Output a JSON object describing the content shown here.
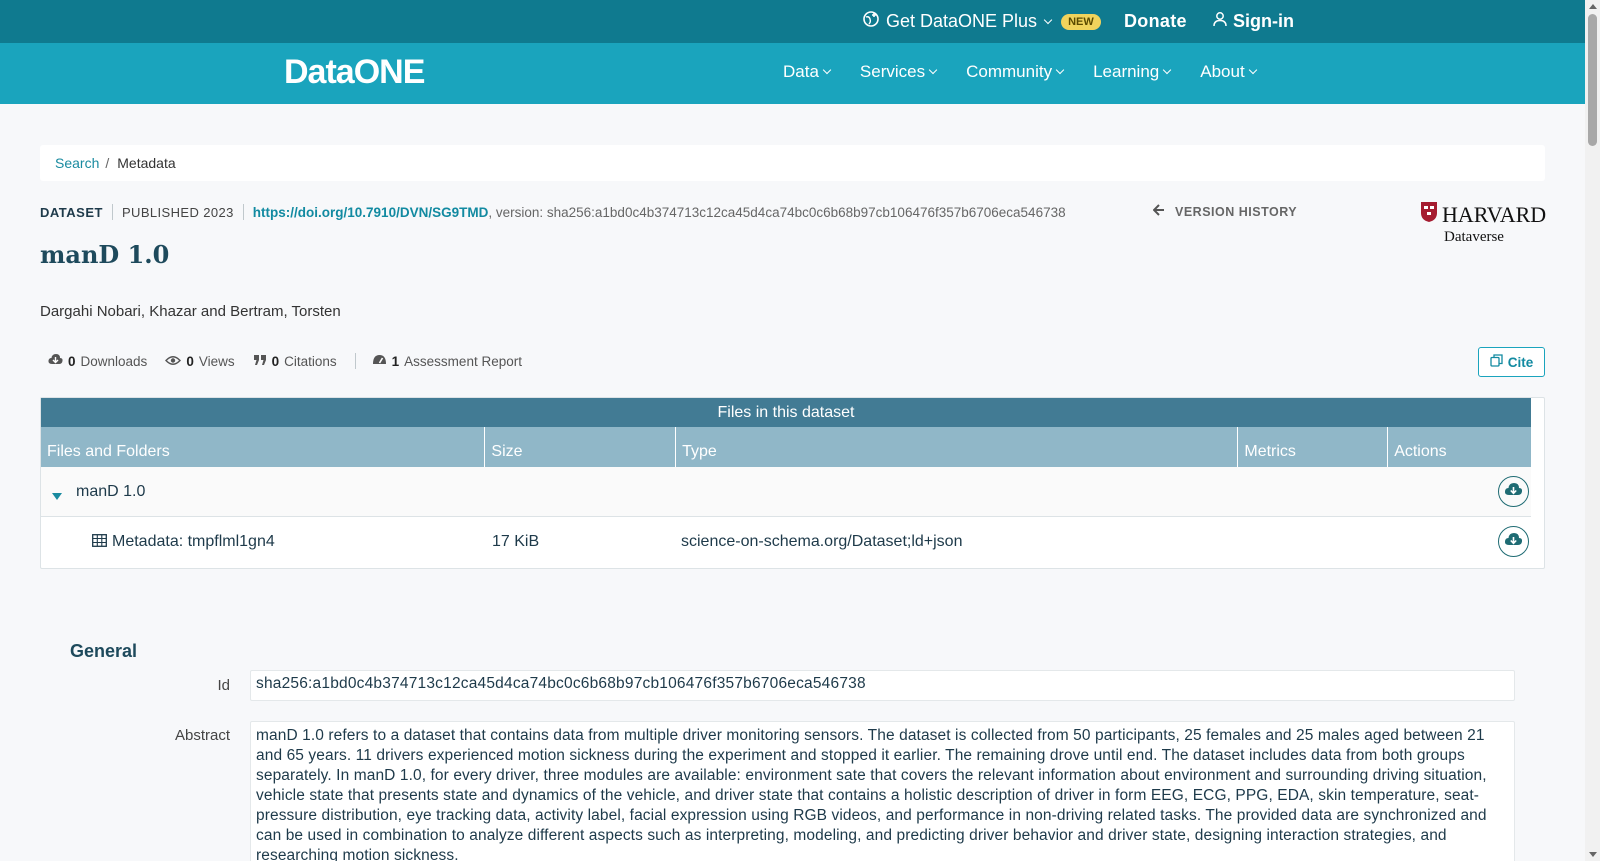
{
  "topbar": {
    "plus_label": "Get DataONE Plus",
    "new_badge": "NEW",
    "donate": "Donate",
    "signin": "Sign-in"
  },
  "navbar": {
    "logo": "DataONE",
    "items": [
      "Data",
      "Services",
      "Community",
      "Learning",
      "About"
    ]
  },
  "breadcrumb": {
    "search": "Search",
    "separator": "/",
    "current": "Metadata"
  },
  "dataset": {
    "type": "DATASET",
    "published": "PUBLISHED 2023",
    "doi": "https://doi.org/10.7910/DVN/SG9TMD",
    "version": ", version: sha256:a1bd0c4b374713c12ca45d4ca74bc0c6b68b97cb106476f357b6706eca546738",
    "version_history": "VERSION HISTORY",
    "repository_name": "HARVARD",
    "repository_sub": "Dataverse",
    "title": "manD 1.0",
    "authors": "Dargahi Nobari, Khazar and Bertram, Torsten"
  },
  "stats": {
    "downloads_count": "0",
    "downloads_label": "Downloads",
    "views_count": "0",
    "views_label": "Views",
    "citations_count": "0",
    "citations_label": "Citations",
    "assessment_count": "1",
    "assessment_label": "Assessment Report",
    "cite": "Cite"
  },
  "files": {
    "heading": "Files in this dataset",
    "columns": [
      "Files and Folders",
      "Size",
      "Type",
      "Metrics",
      "Actions"
    ],
    "folder": "manD 1.0",
    "rows": [
      {
        "name": "Metadata: tmpflml1gn4",
        "size": "17 KiB",
        "type": "science-on-schema.org/Dataset;ld+json"
      }
    ]
  },
  "general": {
    "heading": "General",
    "id_label": "Id",
    "id_value": "sha256:a1bd0c4b374713c12ca45d4ca74bc0c6b68b97cb106476f357b6706eca546738",
    "abstract_label": "Abstract",
    "abstract_value": "manD 1.0 refers to a dataset that contains data from multiple driver monitoring sensors. The dataset is collected from 50 participants, 25 females and 25 males aged between 21 and 65 years. 11 drivers experienced motion sickness during the experiment and stopped it earlier. The remaining drove until end. The dataset includes data from both groups separately. In manD 1.0, for every driver, three modules are available: environment sate that covers the relevant information about environment and surrounding driving situation, vehicle state that presents state and dynamics of the vehicle, and driver state that contains a holistic description of driver in form EEG, ECG, PPG, EDA, skin temperature, seat-pressure distribution, eye tracking data, activity label, facial expression using RGB videos, and performance in non-driving related tasks. The provided data are synchronized and can be used in combination to analyze different aspects such as interpreting, modeling, and predicting driver behavior and driver state, designing interaction strategies, and researching motion sickness."
  }
}
